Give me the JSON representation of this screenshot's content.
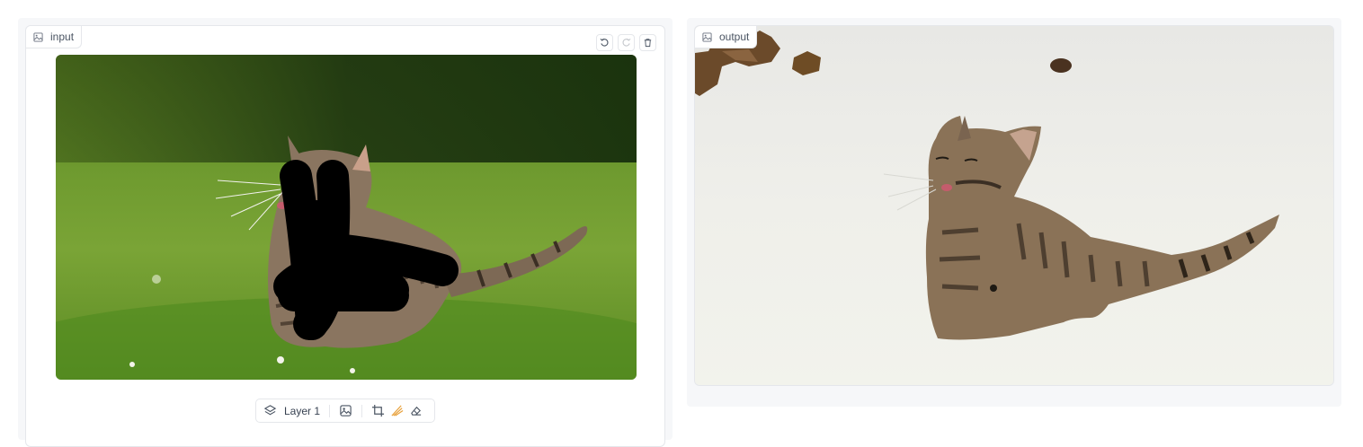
{
  "input_panel": {
    "label": "input",
    "label_icon": "image-icon",
    "buttons": {
      "undo": "undo-icon",
      "redo": "redo-icon",
      "clear": "trash-icon"
    },
    "toolbar": {
      "layer_label": "Layer 1",
      "layers_icon": "layers-icon",
      "image_icon": "image-icon",
      "crop_icon": "crop-icon",
      "brush_icon": "brush-icon",
      "eraser_icon": "eraser-icon",
      "brush_color": "#e8a13b"
    }
  },
  "output_panel": {
    "label": "output",
    "label_icon": "image-icon",
    "download_icon": "download-icon"
  },
  "colors": {
    "grass": "#5f8f2a",
    "dark_foliage": "#1f3a10",
    "mask": "#000000",
    "output_bg": "#efefec"
  }
}
